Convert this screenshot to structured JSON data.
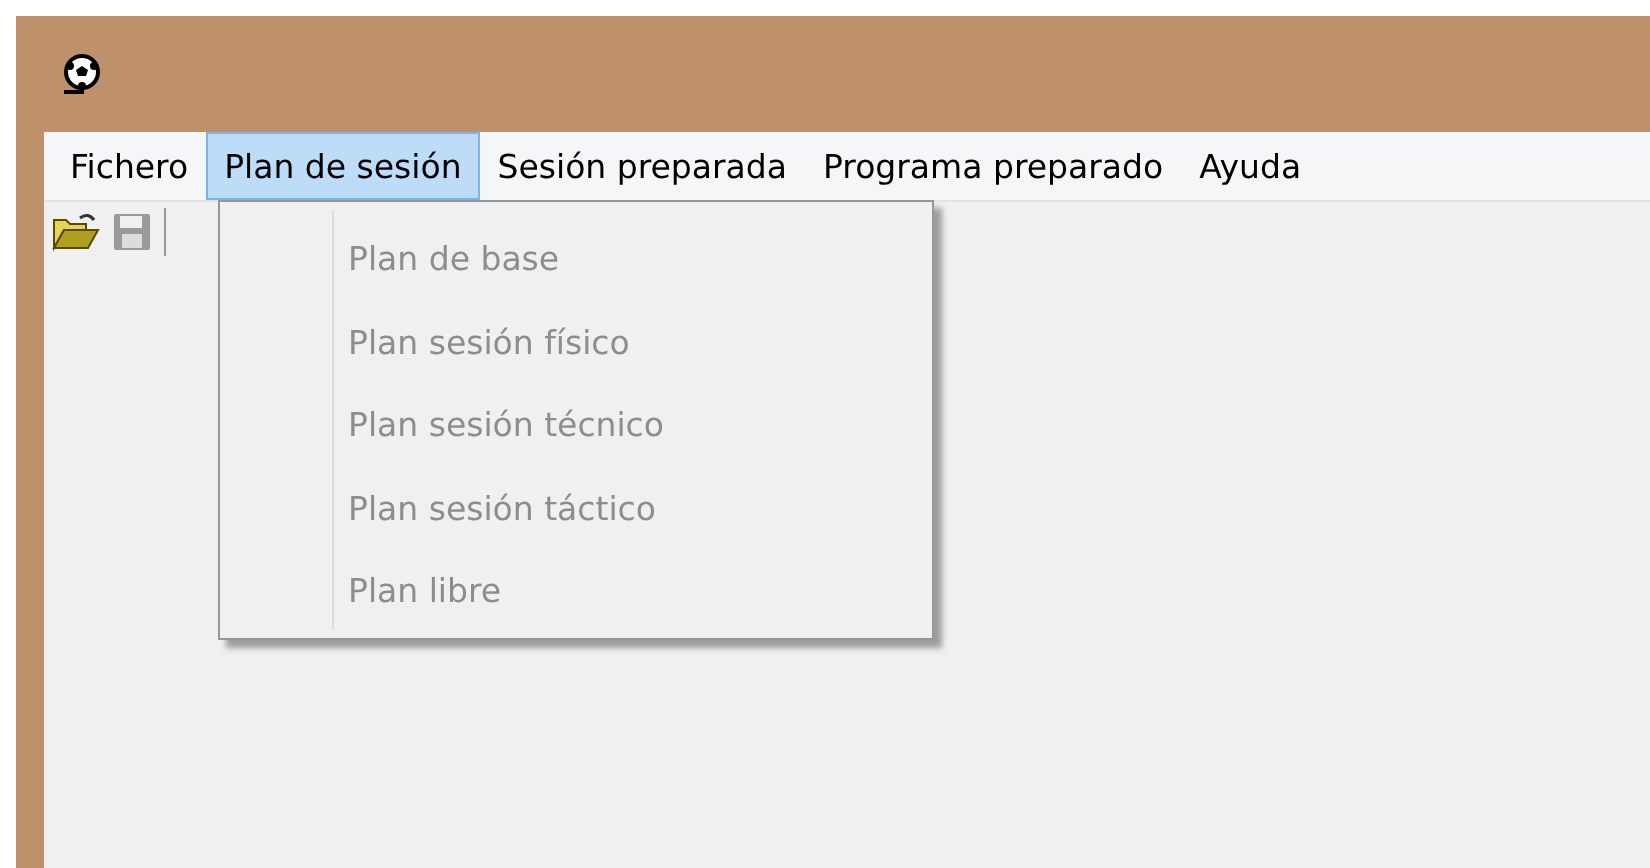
{
  "menu_bar": {
    "items": [
      {
        "label": "Fichero",
        "selected": false
      },
      {
        "label": "Plan de sesión",
        "selected": true
      },
      {
        "label": "Sesión preparada",
        "selected": false
      },
      {
        "label": "Programa preparado",
        "selected": false
      },
      {
        "label": "Ayuda",
        "selected": false
      }
    ]
  },
  "toolbar": {
    "buttons": [
      {
        "kind": "open",
        "disabled": false
      },
      {
        "kind": "save",
        "disabled": true
      }
    ]
  },
  "dropdown": {
    "items": [
      {
        "label": "Plan de base",
        "disabled": true
      },
      {
        "label": "Plan sesión físico",
        "disabled": true
      },
      {
        "label": "Plan sesión técnico",
        "disabled": true
      },
      {
        "label": "Plan sesión táctico",
        "disabled": true
      },
      {
        "label": "Plan libre",
        "disabled": true
      }
    ]
  }
}
